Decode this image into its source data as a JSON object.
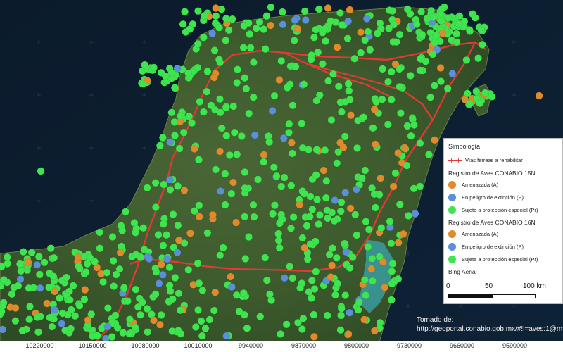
{
  "legend": {
    "title": "Simbología",
    "railways_label": "Vías ferreas a rehabilitar",
    "group_15n_label": "Registro de Aves CONABIO 15N",
    "group_16n_label": "Registro de Aves CONABIO 16N",
    "amenazada_label": "Amenazada (A)",
    "peligro_label": "En peligro de extinción (P)",
    "proteccion_label": "Sujeta a protección especial (Pr)",
    "basemap_label": "Bing Aerial"
  },
  "scale_bar": {
    "label_0": "0",
    "label_50": "50",
    "label_100": "100 km"
  },
  "source_text": "Tomado de: http://geoportal.conabio.gob.mx/#!l=aves:1@m=mixto",
  "x_axis_ticks": [
    "-10220000",
    "-10150000",
    "-10080000",
    "-10010000",
    "-9940000",
    "-9870000",
    "-9800000",
    "-9730000",
    "-9660000",
    "-9590000"
  ],
  "colors": {
    "amenazada": "#e08a2c",
    "peligro": "#5b8fd9",
    "proteccion": "#3ee54f",
    "railway": "#e53935",
    "sea": "#0c1c2d",
    "land": "#3f5a2f"
  },
  "points_summary": {
    "category_order": [
      "proteccion",
      "amenazada",
      "peligro"
    ],
    "approx_share": [
      0.82,
      0.12,
      0.06
    ]
  }
}
